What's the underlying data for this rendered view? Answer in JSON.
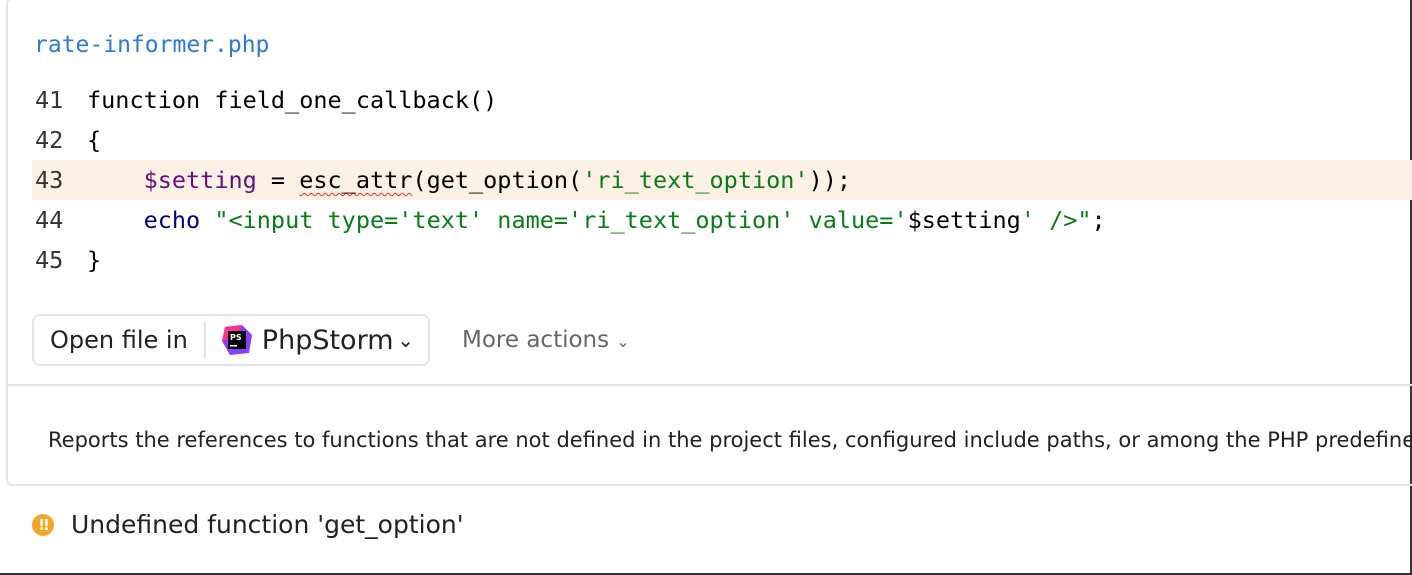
{
  "file": {
    "name": "rate-informer.php"
  },
  "code": {
    "lines": [
      {
        "num": "41",
        "text": "function field_one_callback()"
      },
      {
        "num": "42",
        "text": "{"
      },
      {
        "num": "43",
        "indent": "    ",
        "var": "$setting",
        "op": " = ",
        "fn_err": "esc_attr",
        "rest1": "(get_option(",
        "str": "'ri_text_option'",
        "rest2": "));"
      },
      {
        "num": "44",
        "indent": "    ",
        "kw": "echo",
        "sp": " ",
        "str1": "\"<input type='text' name='ri_text_option' value='",
        "var": "$setting",
        "str2": "' />\"",
        "end": ";"
      },
      {
        "num": "45",
        "text": "}"
      }
    ],
    "highlight_color": "#fdf1e5"
  },
  "actions": {
    "open_file_in": "Open file in",
    "ide": "PhpStorm",
    "ide_icon_text": "PS",
    "more_actions": "More actions"
  },
  "description": "Reports the references to functions that are not defined in the project files, configured include paths, or among the PHP predefined functions.",
  "problem": {
    "severity_icon": "warning-icon",
    "text": "Undefined function 'get_option'",
    "color": "#f5a524"
  }
}
